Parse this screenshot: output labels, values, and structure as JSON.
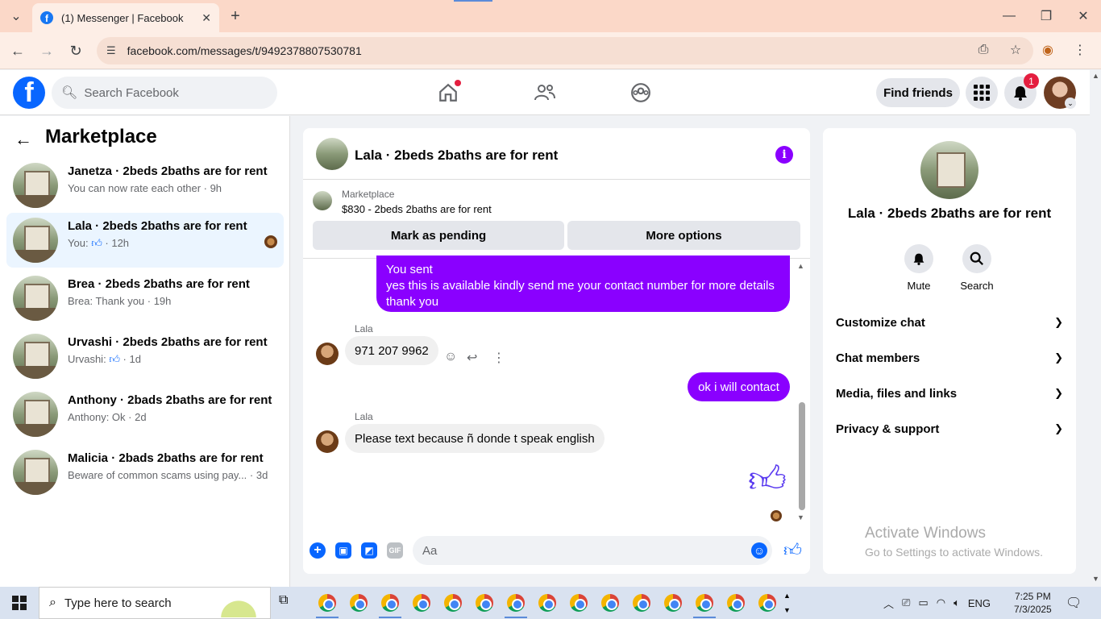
{
  "browser": {
    "tab_title": "(1) Messenger | Facebook",
    "url": "facebook.com/messages/t/9492378807530781"
  },
  "header": {
    "search_placeholder": "Search Facebook",
    "find_friends": "Find friends",
    "notification_count": "1"
  },
  "sidebar": {
    "title": "Marketplace",
    "conversations": [
      {
        "name": "Janetza · 2beds 2baths are for rent",
        "sub": "You can now rate each other · 9h"
      },
      {
        "name": "Lala · 2beds 2baths are for rent",
        "sub_prefix": "You:",
        "sub_suffix": "· 12h"
      },
      {
        "name": "Brea · 2beds 2baths are for rent",
        "sub": "Brea: Thank you · 19h"
      },
      {
        "name": "Urvashi · 2beds 2baths are for rent",
        "sub_prefix": "Urvashi:",
        "sub_suffix": "· 1d"
      },
      {
        "name": "Anthony · 2bads 2baths are for rent",
        "sub": "Anthony: Ok · 2d"
      },
      {
        "name": "Malicia · 2bads 2baths are for rent",
        "sub": "Beware of common scams using pay...  · 3d"
      }
    ]
  },
  "chat": {
    "title": "Lala · 2beds 2baths are for rent",
    "listing_label": "Marketplace",
    "listing_price": "$830 - 2beds 2baths are for rent",
    "mark_pending": "Mark as pending",
    "more_options": "More options",
    "messages": {
      "sent1_label": "You sent",
      "sent1_text": "yes this is available kindly send me your contact number for more details thank you",
      "in1_sender": "Lala",
      "in1_text": "971 207 9962",
      "sent2_text": "ok i will contact",
      "in2_sender": "Lala",
      "in2_text": "Please text because ñ donde t speak english"
    },
    "input_placeholder": "Aa"
  },
  "right_panel": {
    "name": "Lala · 2beds 2baths are for rent",
    "mute": "Mute",
    "search": "Search",
    "rows": [
      "Customize chat",
      "Chat members",
      "Media, files and links",
      "Privacy & support"
    ]
  },
  "watermark": {
    "line1": "Activate Windows",
    "line2": "Go to Settings to activate Windows."
  },
  "taskbar": {
    "search_text": "Type here to search",
    "language": "ENG",
    "time": "7:25 PM",
    "date": "7/3/2025"
  },
  "colors": {
    "messenger_purple": "#8a00ff",
    "facebook_blue": "#0866ff"
  }
}
